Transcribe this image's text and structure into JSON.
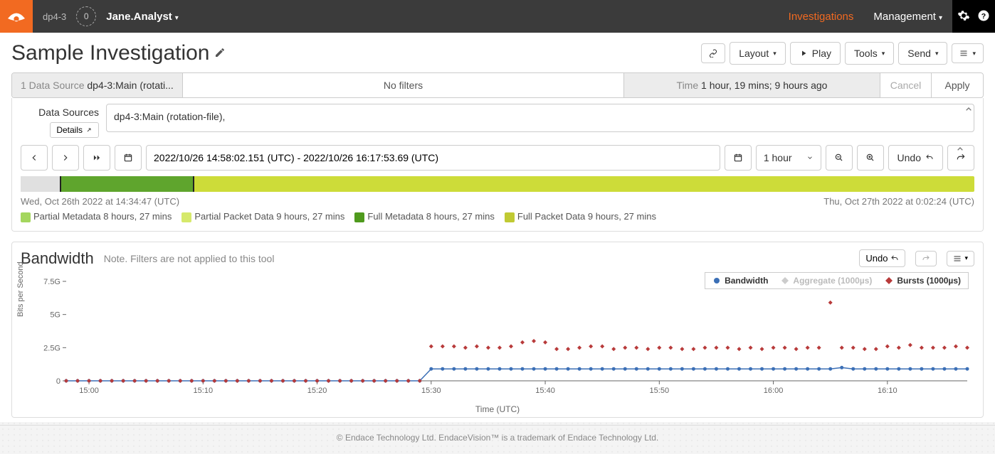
{
  "topnav": {
    "env": "dp4-3",
    "task_count": "0",
    "user": "Jane.Analyst",
    "links": {
      "investigations": "Investigations",
      "management": "Management"
    }
  },
  "title": "Sample Investigation",
  "toolbar": {
    "layout": "Layout",
    "play": "Play",
    "tools": "Tools",
    "send": "Send"
  },
  "summary": {
    "ds_count_label": "1 Data Source",
    "ds_value": "dp4-3:Main (rotati...",
    "filters": "No filters",
    "time_label": "Time",
    "time_value": "1 hour, 19 mins; 9 hours ago",
    "cancel": "Cancel",
    "apply": "Apply"
  },
  "datasources": {
    "label": "Data Sources",
    "details_btn": "Details",
    "value": "dp4-3:Main (rotation-file),"
  },
  "time": {
    "range": "2022/10/26 14:58:02.151 (UTC) - 2022/10/26 16:17:53.69 (UTC)",
    "preset": "1 hour",
    "undo": "Undo"
  },
  "density": {
    "start_label": "Wed, Oct 26th 2022 at 14:34:47 (UTC)",
    "end_label": "Thu, Oct 27th 2022 at 0:02:24 (UTC)",
    "sel_start_pct": 4.1,
    "sel_end_pct": 18.2,
    "partial_end_pct": 12.0,
    "legend": [
      {
        "color": "#a4d65e",
        "text": "Partial Metadata 8 hours, 27 mins"
      },
      {
        "color": "#d6e96b",
        "text": "Partial Packet Data 9 hours, 27 mins"
      },
      {
        "color": "#4f9a1d",
        "text": "Full Metadata 8 hours, 27 mins"
      },
      {
        "color": "#c0ca33",
        "text": "Full Packet Data 9 hours, 27 mins"
      }
    ]
  },
  "bandwidth": {
    "title": "Bandwidth",
    "note": "Note. Filters are not applied to this tool",
    "undo": "Undo",
    "ylabel": "Bits per Second",
    "xlabel": "Time (UTC)",
    "legend": {
      "bandwidth": "Bandwidth",
      "aggregate": "Aggregate (1000µs)",
      "bursts": "Bursts (1000µs)"
    }
  },
  "footer": "© Endace Technology Ltd. EndaceVision™ is a trademark of Endace Technology Ltd.",
  "chart_data": {
    "type": "line",
    "xlabel": "Time (UTC)",
    "ylabel": "Bits per Second",
    "ylim": [
      0,
      7.5
    ],
    "y_unit": "G",
    "y_ticks": [
      0,
      2.5,
      5,
      7.5
    ],
    "x_ticks": [
      "15:00",
      "15:10",
      "15:20",
      "15:30",
      "15:40",
      "15:50",
      "16:00",
      "16:10"
    ],
    "x": [
      "14:58",
      "14:59",
      "15:00",
      "15:01",
      "15:02",
      "15:03",
      "15:04",
      "15:05",
      "15:06",
      "15:07",
      "15:08",
      "15:09",
      "15:10",
      "15:11",
      "15:12",
      "15:13",
      "15:14",
      "15:15",
      "15:16",
      "15:17",
      "15:18",
      "15:19",
      "15:20",
      "15:21",
      "15:22",
      "15:23",
      "15:24",
      "15:25",
      "15:26",
      "15:27",
      "15:28",
      "15:29",
      "15:30",
      "15:31",
      "15:32",
      "15:33",
      "15:34",
      "15:35",
      "15:36",
      "15:37",
      "15:38",
      "15:39",
      "15:40",
      "15:41",
      "15:42",
      "15:43",
      "15:44",
      "15:45",
      "15:46",
      "15:47",
      "15:48",
      "15:49",
      "15:50",
      "15:51",
      "15:52",
      "15:53",
      "15:54",
      "15:55",
      "15:56",
      "15:57",
      "15:58",
      "15:59",
      "16:00",
      "16:01",
      "16:02",
      "16:03",
      "16:04",
      "16:05",
      "16:06",
      "16:07",
      "16:08",
      "16:09",
      "16:10",
      "16:11",
      "16:12",
      "16:13",
      "16:14",
      "16:15",
      "16:16",
      "16:17"
    ],
    "series": [
      {
        "name": "Bandwidth",
        "color": "#3b6fb6",
        "values": [
          0,
          0,
          0,
          0,
          0,
          0,
          0,
          0,
          0,
          0,
          0,
          0,
          0,
          0,
          0,
          0,
          0,
          0,
          0,
          0,
          0,
          0,
          0,
          0,
          0,
          0,
          0,
          0,
          0,
          0,
          0,
          0,
          0.9,
          0.9,
          0.9,
          0.9,
          0.9,
          0.9,
          0.9,
          0.9,
          0.9,
          0.9,
          0.9,
          0.9,
          0.9,
          0.9,
          0.9,
          0.9,
          0.9,
          0.9,
          0.9,
          0.9,
          0.9,
          0.9,
          0.9,
          0.9,
          0.9,
          0.9,
          0.9,
          0.9,
          0.9,
          0.9,
          0.9,
          0.9,
          0.9,
          0.9,
          0.9,
          0.9,
          1.0,
          0.9,
          0.9,
          0.9,
          0.9,
          0.9,
          0.9,
          0.9,
          0.9,
          0.9,
          0.9,
          0.9
        ]
      },
      {
        "name": "Bursts (1000µs)",
        "color": "#b83a3a",
        "values": [
          0,
          0,
          0,
          0,
          0,
          0,
          0,
          0,
          0,
          0,
          0,
          0,
          0,
          0,
          0,
          0,
          0,
          0,
          0,
          0,
          0,
          0,
          0,
          0,
          0,
          0,
          0,
          0,
          0,
          0,
          0,
          0,
          2.6,
          2.6,
          2.6,
          2.5,
          2.6,
          2.5,
          2.5,
          2.6,
          2.9,
          3.0,
          2.9,
          2.4,
          2.4,
          2.5,
          2.6,
          2.6,
          2.4,
          2.5,
          2.5,
          2.4,
          2.5,
          2.5,
          2.4,
          2.4,
          2.5,
          2.5,
          2.5,
          2.4,
          2.5,
          2.4,
          2.5,
          2.5,
          2.4,
          2.5,
          2.5,
          5.9,
          2.5,
          2.5,
          2.4,
          2.4,
          2.6,
          2.5,
          2.7,
          2.5,
          2.5,
          2.5,
          2.6,
          2.5
        ]
      }
    ]
  }
}
